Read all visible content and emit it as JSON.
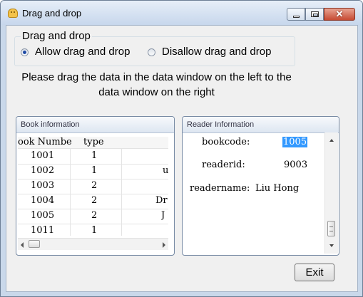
{
  "window": {
    "title": "Drag and drop",
    "close_glyph": "✕"
  },
  "options": {
    "group_title": "Drag and drop",
    "allow_label": "Allow drag and drop",
    "disallow_label": "Disallow drag and drop",
    "selected": "allow"
  },
  "instruction": {
    "line1": "Please drag the data in the data window on the left to the",
    "line2": "data window on the right"
  },
  "book_panel": {
    "title": "Book information",
    "columns": [
      "ook Numbe",
      "type"
    ],
    "rows": [
      {
        "number": "1001",
        "type": "1",
        "extra": ""
      },
      {
        "number": "1002",
        "type": "1",
        "extra": "u"
      },
      {
        "number": "1003",
        "type": "2",
        "extra": ""
      },
      {
        "number": "1004",
        "type": "2",
        "extra": "Dr"
      },
      {
        "number": "1005",
        "type": "2",
        "extra": "J"
      },
      {
        "number": "1011",
        "type": "1",
        "extra": ""
      }
    ]
  },
  "reader_panel": {
    "title": "Reader Information",
    "bookcode_label": "bookcode:",
    "bookcode_value": "1005",
    "readerid_label": "readerid:",
    "readerid_value": "9003",
    "readername_label": "readername:",
    "readername_value": "Liu Hong"
  },
  "exit_label": "Exit",
  "colors": {
    "selection": "#3399ff",
    "title_bar": "#c7d7ec",
    "close_button": "#c74a33"
  },
  "icons": [
    "app-icon",
    "minimize-icon",
    "maximize-icon",
    "close-icon",
    "radio-selected-icon",
    "radio-unselected-icon",
    "arrow-left-icon",
    "arrow-right-icon",
    "arrow-up-icon",
    "arrow-down-icon"
  ]
}
